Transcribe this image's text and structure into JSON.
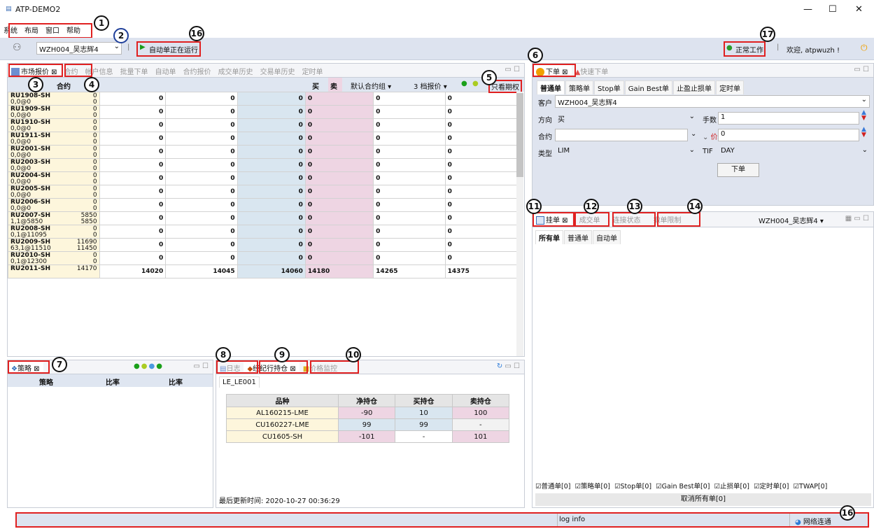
{
  "window": {
    "title": "ATP-DEMO2",
    "controls": [
      "—",
      "☐",
      "✕"
    ]
  },
  "menu": [
    "系统",
    "布局",
    "窗口",
    "帮助"
  ],
  "toolbar": {
    "account": "WZH004_吴志辉4",
    "auto_status": "自动单正在运行",
    "work_status": "正常工作",
    "welcome": "欢迎, atpwuzh !"
  },
  "market": {
    "tabs": [
      "市场报价",
      "合约",
      "帐户信息",
      "批量下单",
      "自动单",
      "合约报价",
      "成交单历史",
      "交易单历史",
      "定时单"
    ],
    "header": {
      "contract": "合约",
      "buy": "买",
      "sell": "卖",
      "group": "默认合约组",
      "depth": "3 档报价",
      "option_only": "只看期权"
    },
    "rows": [
      {
        "name": "RU1908-SH",
        "sub": "0,0@0",
        "r1": "0",
        "r2": "0",
        "bid": [
          "0",
          "0",
          "0"
        ],
        "ask": [
          "0",
          "0",
          "0"
        ]
      },
      {
        "name": "RU1909-SH",
        "sub": "0,0@0",
        "r1": "0",
        "r2": "0",
        "bid": [
          "0",
          "0",
          "0"
        ],
        "ask": [
          "0",
          "0",
          "0"
        ]
      },
      {
        "name": "RU1910-SH",
        "sub": "0,0@0",
        "r1": "0",
        "r2": "0",
        "bid": [
          "0",
          "0",
          "0"
        ],
        "ask": [
          "0",
          "0",
          "0"
        ]
      },
      {
        "name": "RU1911-SH",
        "sub": "0,0@0",
        "r1": "0",
        "r2": "0",
        "bid": [
          "0",
          "0",
          "0"
        ],
        "ask": [
          "0",
          "0",
          "0"
        ]
      },
      {
        "name": "RU2001-SH",
        "sub": "0,0@0",
        "r1": "0",
        "r2": "0",
        "bid": [
          "0",
          "0",
          "0"
        ],
        "ask": [
          "0",
          "0",
          "0"
        ]
      },
      {
        "name": "RU2003-SH",
        "sub": "0,0@0",
        "r1": "0",
        "r2": "0",
        "bid": [
          "0",
          "0",
          "0"
        ],
        "ask": [
          "0",
          "0",
          "0"
        ]
      },
      {
        "name": "RU2004-SH",
        "sub": "0,0@0",
        "r1": "0",
        "r2": "0",
        "bid": [
          "0",
          "0",
          "0"
        ],
        "ask": [
          "0",
          "0",
          "0"
        ]
      },
      {
        "name": "RU2005-SH",
        "sub": "0,0@0",
        "r1": "0",
        "r2": "0",
        "bid": [
          "0",
          "0",
          "0"
        ],
        "ask": [
          "0",
          "0",
          "0"
        ]
      },
      {
        "name": "RU2006-SH",
        "sub": "0,0@0",
        "r1": "0",
        "r2": "0",
        "bid": [
          "0",
          "0",
          "0"
        ],
        "ask": [
          "0",
          "0",
          "0"
        ]
      },
      {
        "name": "RU2007-SH",
        "sub": "1,1@5850",
        "r1": "5850",
        "r2": "5850",
        "bid": [
          "0",
          "0",
          "0"
        ],
        "ask": [
          "0",
          "0",
          "0"
        ]
      },
      {
        "name": "RU2008-SH",
        "sub": "0,1@11095",
        "r1": "0",
        "r2": "0",
        "bid": [
          "0",
          "0",
          "0"
        ],
        "ask": [
          "0",
          "0",
          "0"
        ]
      },
      {
        "name": "RU2009-SH",
        "sub": "63,1@11510",
        "r1": "11690",
        "r2": "11450",
        "bid": [
          "0",
          "0",
          "0"
        ],
        "ask": [
          "0",
          "0",
          "0"
        ]
      },
      {
        "name": "RU2010-SH",
        "sub": "0,1@12300",
        "r1": "0",
        "r2": "0",
        "bid": [
          "0",
          "0",
          "0"
        ],
        "ask": [
          "0",
          "0",
          "0"
        ]
      },
      {
        "name": "RU2011-SH",
        "sub": "",
        "r1": "14170",
        "r2": "",
        "bid": [
          "14020",
          "14045",
          "14060"
        ],
        "ask": [
          "14180",
          "14265",
          "14375"
        ]
      }
    ]
  },
  "order": {
    "tabs": [
      "下单",
      "快速下单"
    ],
    "subtabs": [
      "普通单",
      "策略单",
      "Stop单",
      "Gain Best单",
      "止盈止损单",
      "定时单"
    ],
    "client_label": "客户",
    "client_value": "WZH004_吴志辉4",
    "direction_label": "方向",
    "direction_value": "买",
    "qty_label": "手数",
    "qty_value": "1",
    "contract_label": "合约",
    "contract_value": "",
    "price_label": "价格",
    "price_value": "0",
    "type_label": "类型",
    "type_value": "LIM",
    "tif_label": "TIF",
    "tif_value": "DAY",
    "submit": "下单"
  },
  "pending": {
    "tabs": [
      "挂单",
      "成交单",
      "连接状态",
      "撤单限制"
    ],
    "account": "WZH004_吴志辉4",
    "subtabs": [
      "所有单",
      "普通单",
      "自动单"
    ],
    "filters": [
      "普通单[0]",
      "策略单[0]",
      "Stop单[0]",
      "Gain Best单[0]",
      "止损单[0]",
      "定时单[0]",
      "TWAP[0]"
    ],
    "cancel_all": "取消所有单[0]"
  },
  "strategy": {
    "tab": "策略",
    "cols": [
      "策略",
      "比率",
      "比率"
    ]
  },
  "positions": {
    "tabs": [
      "日志",
      "经纪行持仓",
      "价格监控"
    ],
    "account_tab": "LE_LE001",
    "cols": [
      "品种",
      "净持仓",
      "买持仓",
      "卖持仓"
    ],
    "rows": [
      {
        "name": "AL160215-LME",
        "net": "-90",
        "buy": "10",
        "sell": "100"
      },
      {
        "name": "CU160227-LME",
        "net": "99",
        "buy": "99",
        "sell": "-"
      },
      {
        "name": "CU1605-SH",
        "net": "-101",
        "buy": "-",
        "sell": "101"
      }
    ],
    "updated": "最后更新时间: 2020-10-27 00:36:29"
  },
  "statusbar": {
    "log": "log info",
    "network": "网络连通"
  },
  "badges": [
    "1",
    "2",
    "16",
    "17",
    "6",
    "3",
    "4",
    "5",
    "11",
    "12",
    "13",
    "14",
    "7",
    "8",
    "9",
    "10",
    "16"
  ]
}
